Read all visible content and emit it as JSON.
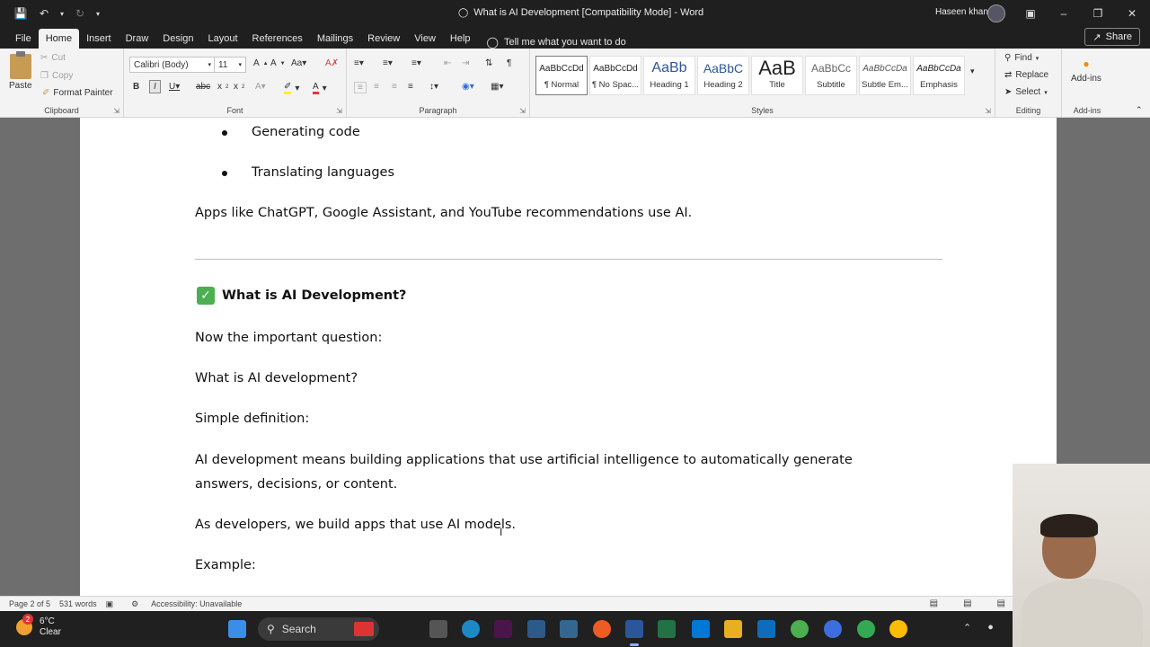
{
  "window": {
    "title": "What is AI Development [Compatibility Mode]  -  Word",
    "user_name": "Haseen khan"
  },
  "ribbon_tabs": [
    "File",
    "Home",
    "Insert",
    "Draw",
    "Design",
    "Layout",
    "References",
    "Mailings",
    "Review",
    "View",
    "Help"
  ],
  "tell_me": "Tell me what you want to do",
  "share_label": "Share",
  "clipboard": {
    "paste": "Paste",
    "cut": "Cut",
    "copy": "Copy",
    "format_painter": "Format Painter",
    "group_label": "Clipboard"
  },
  "font": {
    "name": "Calibri (Body)",
    "size": "11",
    "group_label": "Font"
  },
  "paragraph": {
    "group_label": "Paragraph"
  },
  "styles": {
    "group_label": "Styles",
    "items": [
      {
        "preview": "AaBbCcDd",
        "name": "¶ Normal"
      },
      {
        "preview": "AaBbCcDd",
        "name": "¶ No Spac..."
      },
      {
        "preview": "AaBb",
        "name": "Heading 1"
      },
      {
        "preview": "AaBbC",
        "name": "Heading 2"
      },
      {
        "preview": "AaB",
        "name": "Title"
      },
      {
        "preview": "AaBbCc",
        "name": "Subtitle"
      },
      {
        "preview": "AaBbCcDa",
        "name": "Subtle Em..."
      },
      {
        "preview": "AaBbCcDa",
        "name": "Emphasis"
      }
    ]
  },
  "editing": {
    "find": "Find",
    "replace": "Replace",
    "select": "Select",
    "group_label": "Editing"
  },
  "addins": {
    "button": "Add-ins",
    "group_label": "Add-ins"
  },
  "document": {
    "bullets": [
      "Generating code",
      "Translating languages"
    ],
    "apps_line": "Apps like ChatGPT, Google Assistant, and YouTube recommendations use AI.",
    "heading": "What is AI Development?",
    "lines": [
      "Now the important question:",
      "What is AI development?",
      "Simple definition:",
      "AI development means building applications that use artificial intelligence to automatically generate",
      "answers, decisions, or content.",
      "As developers, we build apps that use AI models.",
      "Example:"
    ]
  },
  "status": {
    "page": "Page 2 of 5",
    "words": "531 words",
    "accessibility": "Accessibility: Unavailable"
  },
  "taskbar": {
    "temp": "6°C",
    "condition": "Clear",
    "weather_badge": "2",
    "search": "Search"
  }
}
